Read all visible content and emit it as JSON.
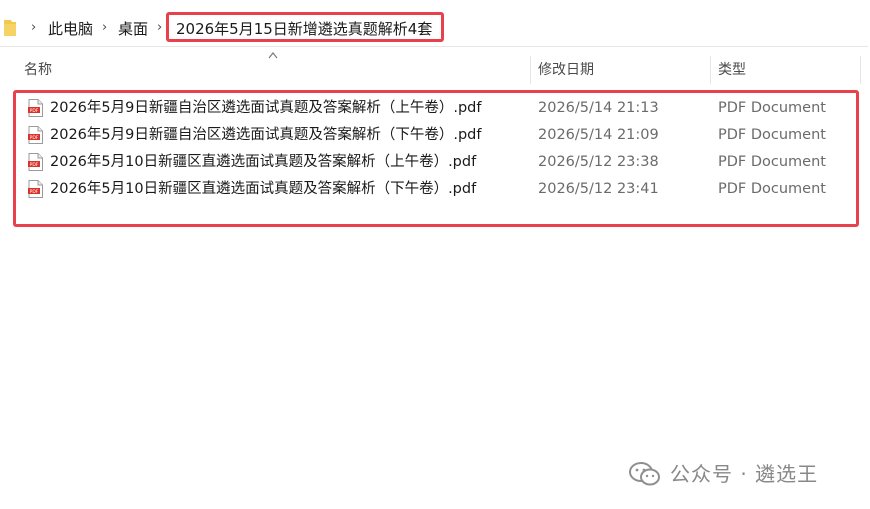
{
  "breadcrumb": {
    "items": [
      "此电脑",
      "桌面",
      "2026年5月15日新增遴选真题解析4套"
    ]
  },
  "columns": {
    "name": "名称",
    "modified": "修改日期",
    "type": "类型"
  },
  "files": [
    {
      "name": "2026年5月9日新疆自治区遴选面试真题及答案解析（上午卷）.pdf",
      "modified": "2026/5/14 21:13",
      "type": "PDF Document"
    },
    {
      "name": "2026年5月9日新疆自治区遴选面试真题及答案解析（下午卷）.pdf",
      "modified": "2026/5/14 21:09",
      "type": "PDF Document"
    },
    {
      "name": "2026年5月10日新疆区直遴选面试真题及答案解析（上午卷）.pdf",
      "modified": "2026/5/12 23:38",
      "type": "PDF Document"
    },
    {
      "name": "2026年5月10日新疆区直遴选面试真题及答案解析（下午卷）.pdf",
      "modified": "2026/5/12 23:41",
      "type": "PDF Document"
    }
  ],
  "watermark": {
    "text": "公众号 · 遴选王",
    "icon": "wechat-icon"
  },
  "colors": {
    "highlight": "#e9414c",
    "pdf_icon": "#d9342b",
    "folder": "#f2c94c"
  }
}
